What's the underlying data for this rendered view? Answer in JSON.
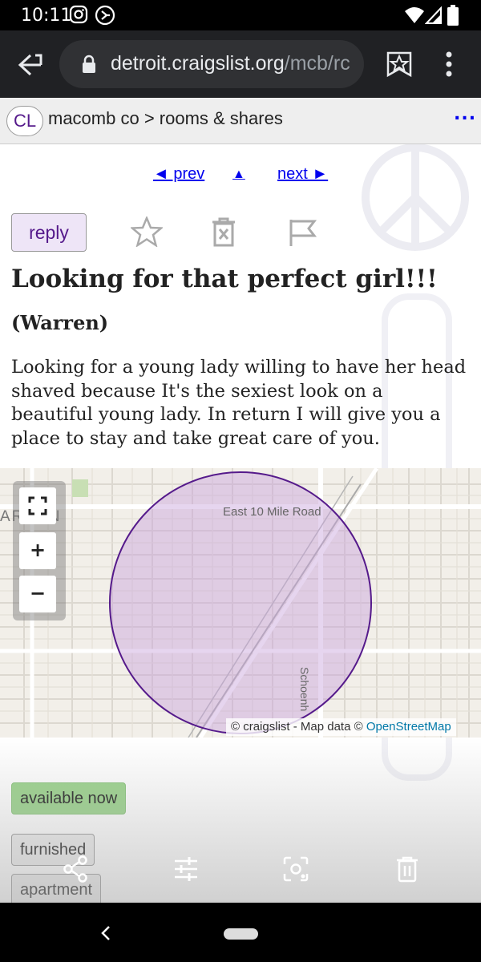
{
  "status_bar": {
    "time": "10:11",
    "icons": [
      "instagram-icon",
      "cast-icon",
      "wifi-icon",
      "signal-icon",
      "battery-icon"
    ]
  },
  "browser": {
    "url_host": "detroit.craigslist.org",
    "url_path": "/mcb/rc",
    "icons": [
      "back-icon",
      "lock-icon",
      "bookmark-star-icon",
      "menu-dots-icon"
    ]
  },
  "header": {
    "logo": "CL",
    "breadcrumb": "macomb co > rooms & shares",
    "more": "..."
  },
  "nav": {
    "prev": "◄ prev",
    "up": "▲",
    "next": "next ►"
  },
  "actions": {
    "reply": "reply",
    "icons": [
      "favorite-star-icon",
      "hide-trash-icon",
      "flag-icon"
    ]
  },
  "posting": {
    "title": "Looking for that perfect girl!!!",
    "location": "(Warren)",
    "body": "Looking for a young lady willing to have her head shaved because It's the sexiest look on a beautiful young lady. In return I will give you a place to stay and take great care of you."
  },
  "map": {
    "label_city": "ARREN",
    "label_road": "East 10 Mile Road",
    "label_street": "Schoenh",
    "zoom_in": "+",
    "zoom_out": "−",
    "attribution_prefix": "© craigslist - Map data ©",
    "attribution_link": "OpenStreetMap"
  },
  "tags": {
    "availability": "available now",
    "furnished": "furnished",
    "housing_type": "apartment"
  },
  "toolbar_icons": [
    "share-icon",
    "adjust-icon",
    "lens-icon",
    "delete-icon"
  ],
  "colors": {
    "link": "#0000ee",
    "visited": "#551a8b",
    "reply_bg": "#eee5f7",
    "available_bg": "#9bd48c",
    "map_circle": "#551a8b"
  }
}
